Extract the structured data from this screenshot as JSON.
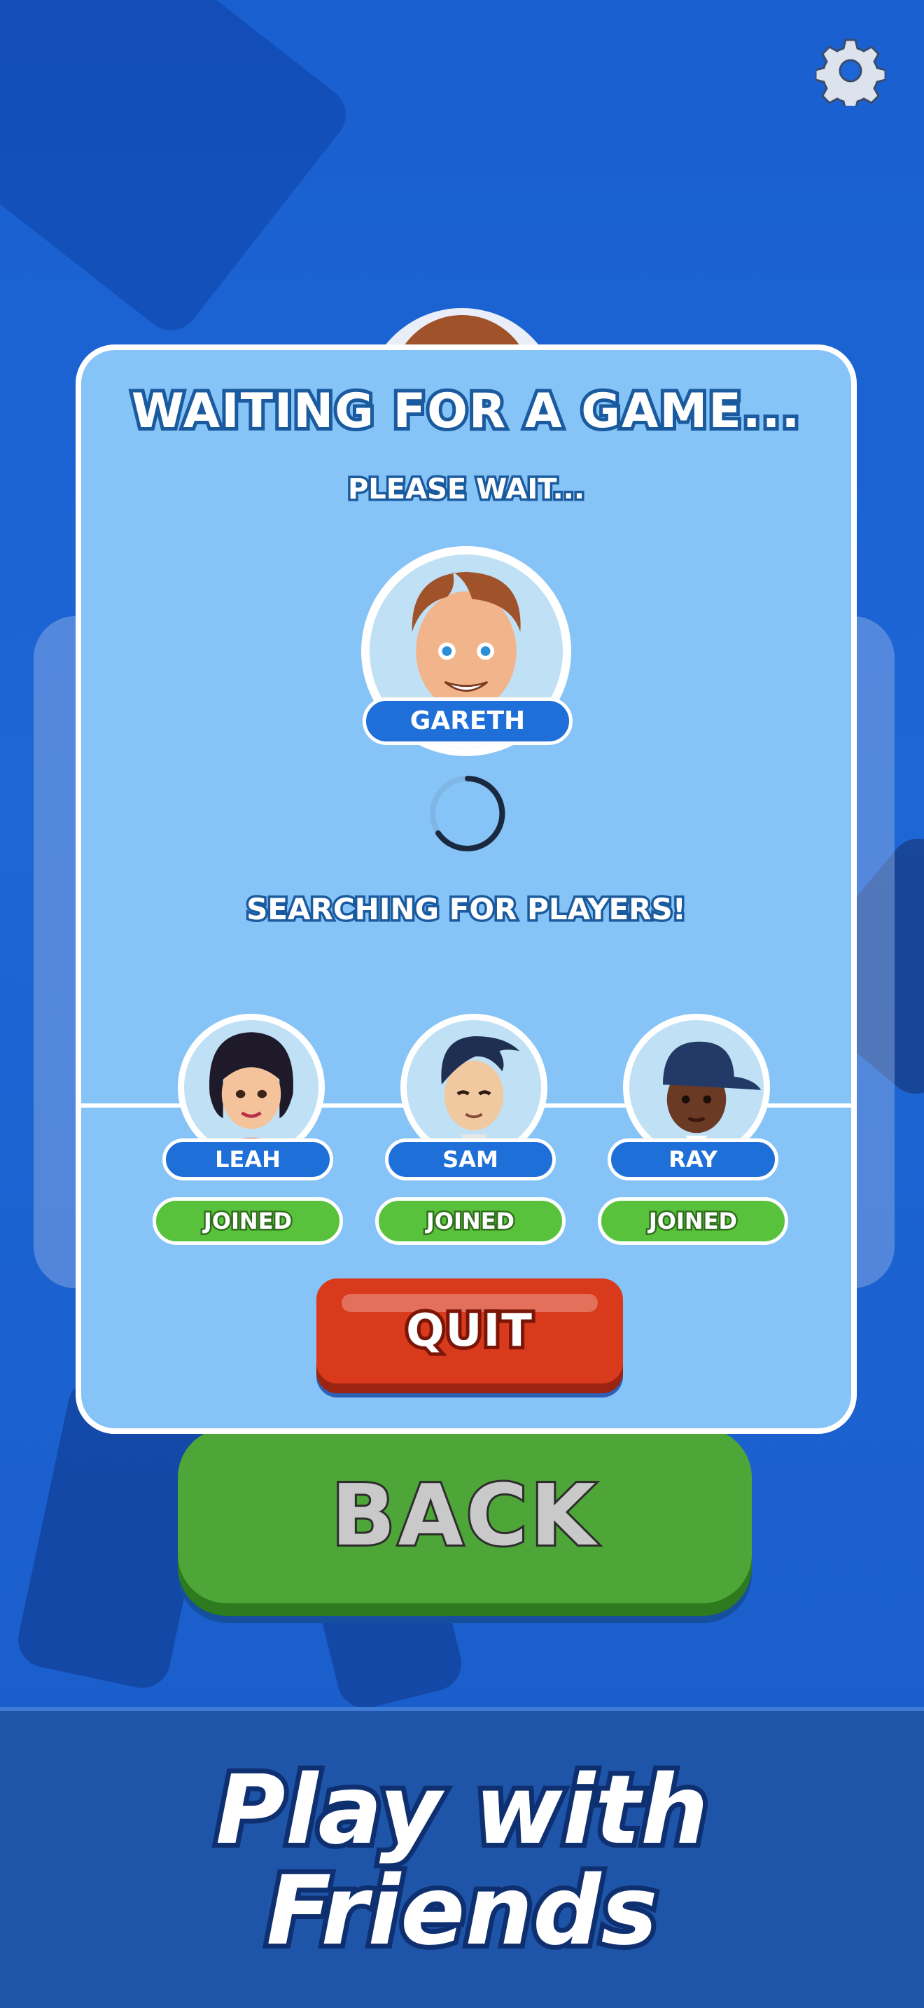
{
  "modal": {
    "title": "WAITING FOR A GAME...",
    "subtitle": "PLEASE WAIT...",
    "host_name": "GARETH",
    "searching_text": "SEARCHING FOR PLAYERS!",
    "quit_label": "QUIT"
  },
  "players": [
    {
      "name": "LEAH",
      "status": "JOINED"
    },
    {
      "name": "SAM",
      "status": "JOINED"
    },
    {
      "name": "RAY",
      "status": "JOINED"
    }
  ],
  "back_label": "BACK",
  "footer": {
    "tagline_line1": "Play with",
    "tagline_line2": "Friends"
  },
  "icons": {
    "settings": "gear-icon",
    "loading": "spinner-icon"
  },
  "colors": {
    "background": "#1c66d6",
    "modal": "#86c3f7",
    "name_pill": "#1f6fd8",
    "joined": "#58c23c",
    "quit": "#d83a1b",
    "back": "#4ea638"
  }
}
